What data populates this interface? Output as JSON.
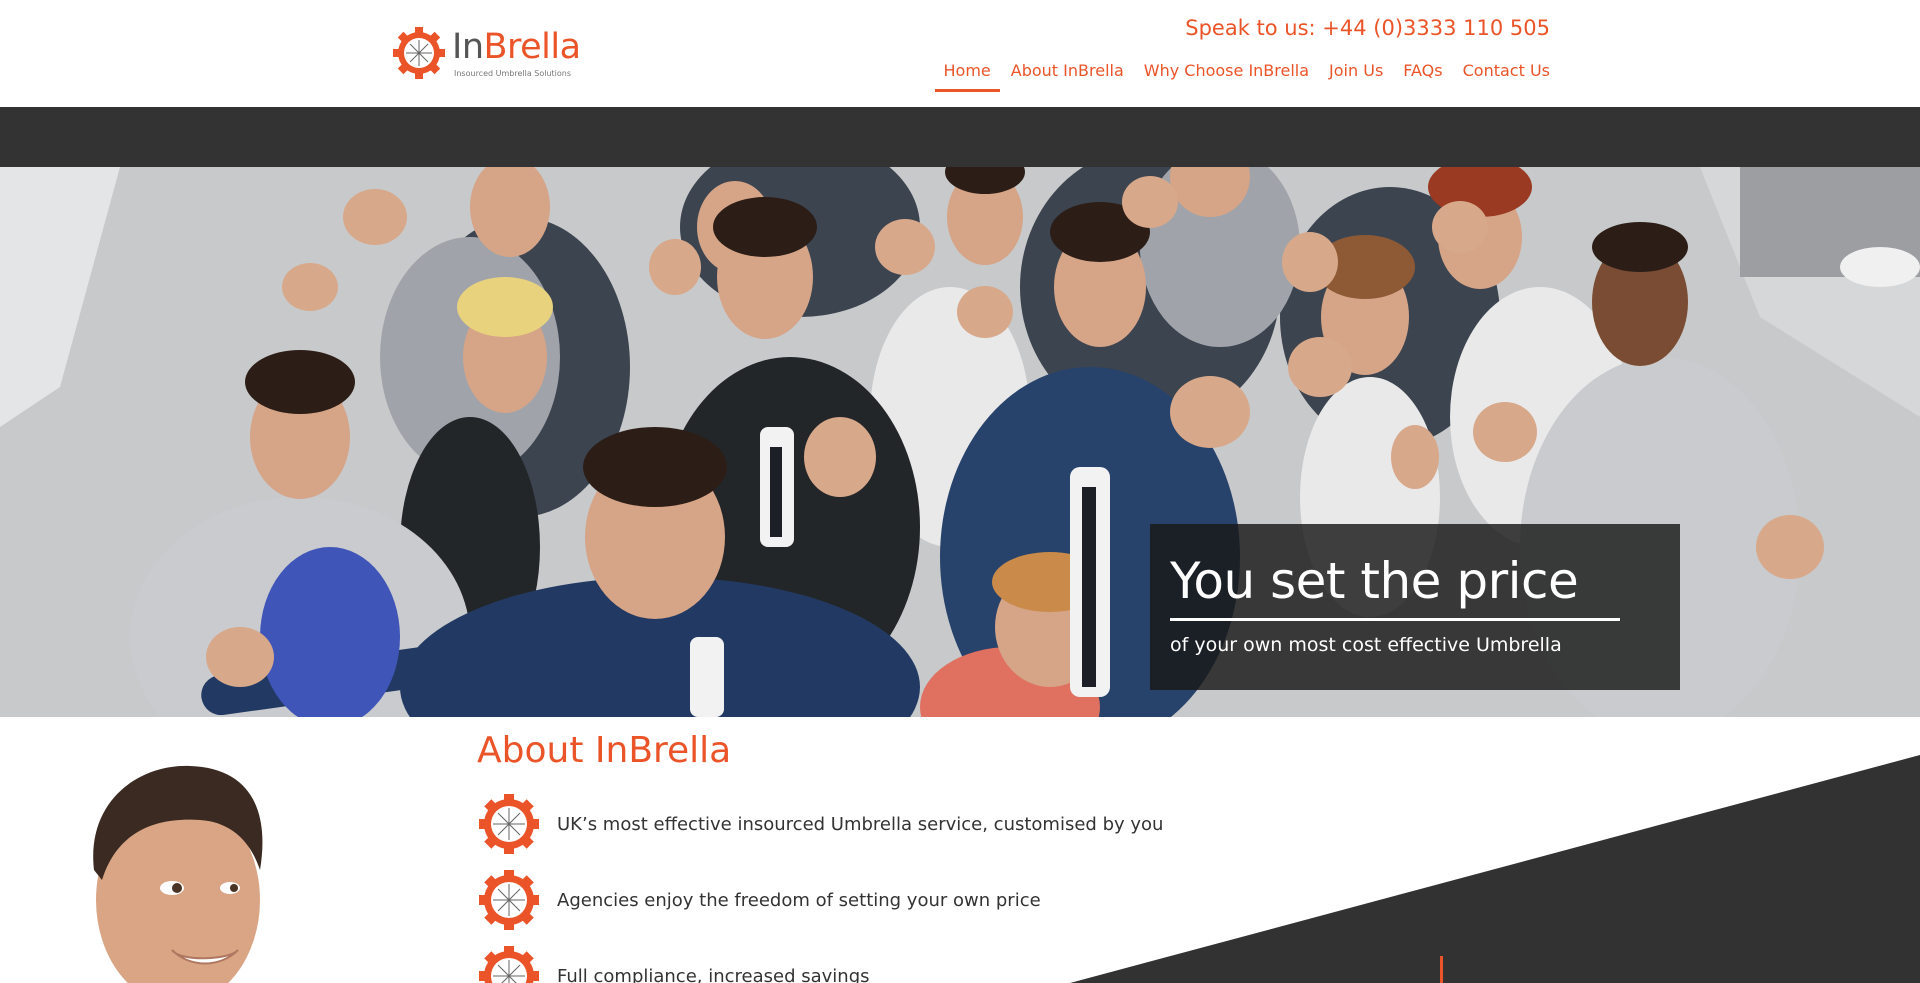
{
  "brand": {
    "name_prefix": "In",
    "name_suffix": "Brella",
    "tagline": "Insourced Umbrella Solutions",
    "accent_color": "#ea5428",
    "dark_color": "#333333"
  },
  "header": {
    "phone": "Speak to us: +44 (0)3333 110 505"
  },
  "nav": {
    "items": [
      {
        "label": "Home",
        "active": true
      },
      {
        "label": "About InBrella",
        "active": false
      },
      {
        "label": "Why Choose InBrella",
        "active": false
      },
      {
        "label": "Join Us",
        "active": false
      },
      {
        "label": "FAQs",
        "active": false
      },
      {
        "label": "Contact Us",
        "active": false
      }
    ]
  },
  "hero": {
    "title": "You set the price",
    "subtitle": "of your own most cost effective Umbrella",
    "image_icon": "group-thumbs-up-photo"
  },
  "about": {
    "heading": "About InBrella",
    "features": [
      {
        "icon": "umbrella-gear-icon",
        "text": "UK’s most effective insourced Umbrella service, customised by you"
      },
      {
        "icon": "umbrella-gear-icon",
        "text": "Agencies enjoy the freedom of setting your own price"
      },
      {
        "icon": "umbrella-gear-icon",
        "text": "Full compliance, increased savings"
      }
    ]
  }
}
